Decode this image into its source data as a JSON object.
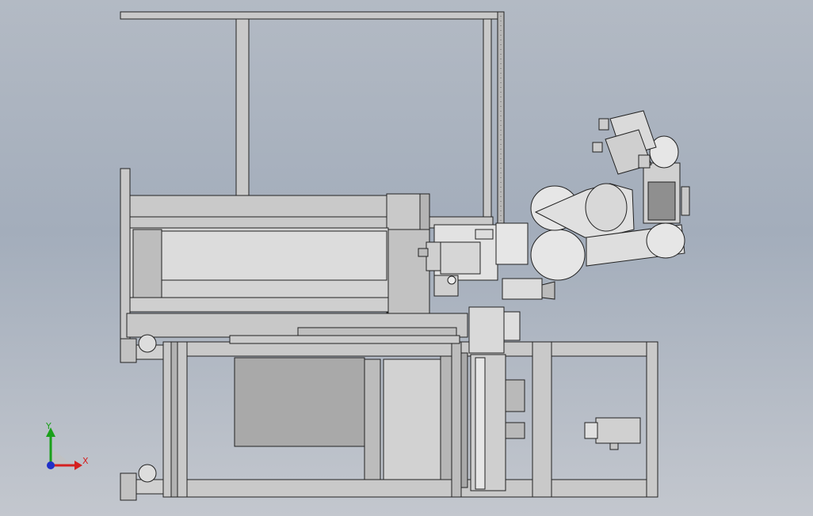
{
  "viewport": {
    "background_top": "#b3bac4",
    "background_bottom": "#c3c7ce"
  },
  "colors": {
    "frame_fill": "#c9c9c9",
    "frame_dark": "#9d9d9d",
    "panel_fill": "#a9a9a9",
    "robot_fill": "#e6e6e6",
    "robot_shade": "#bdbdbd",
    "axis_x": "#d42020",
    "axis_y": "#1aa01a",
    "axis_z": "#2030c8"
  },
  "triad": {
    "x_label": "X",
    "y_label": "Y",
    "icon": "coordinate-triad-icon"
  }
}
